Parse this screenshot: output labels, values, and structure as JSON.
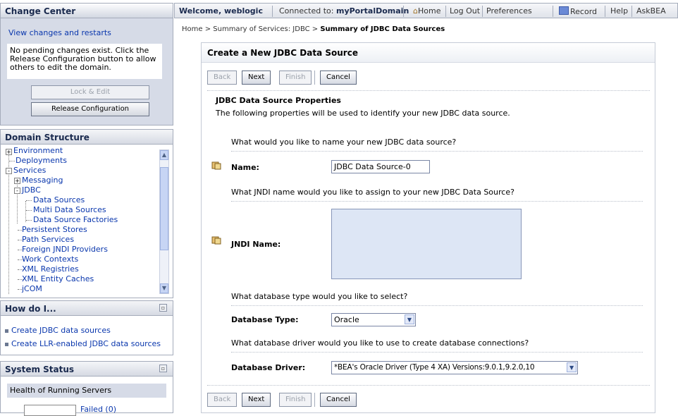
{
  "change_center": {
    "title": "Change Center",
    "link": "View changes and restarts",
    "message": "No pending changes exist. Click the Release Configuration button to allow others to edit the domain.",
    "lock_label": "Lock & Edit",
    "release_label": "Release Configuration"
  },
  "domain_structure": {
    "title": "Domain Structure",
    "items": [
      {
        "label": "Environment",
        "expander": "+"
      },
      {
        "label": "Deployments"
      },
      {
        "label": "Services",
        "expander": "-"
      },
      {
        "label": "Messaging",
        "expander": "+"
      },
      {
        "label": "JDBC",
        "expander": "-"
      },
      {
        "label": "Data Sources"
      },
      {
        "label": "Multi Data Sources"
      },
      {
        "label": "Data Source Factories"
      },
      {
        "label": "Persistent Stores"
      },
      {
        "label": "Path Services"
      },
      {
        "label": "Foreign JNDI Providers"
      },
      {
        "label": "Work Contexts"
      },
      {
        "label": "XML Registries"
      },
      {
        "label": "XML Entity Caches"
      },
      {
        "label": "jCOM"
      }
    ]
  },
  "how_do_i": {
    "title": "How do I...",
    "items": [
      "Create JDBC data sources",
      "Create LLR-enabled JDBC data sources"
    ]
  },
  "system_status": {
    "title": "System Status",
    "health_label": "Health of Running Servers",
    "failed_label": "Failed (0)"
  },
  "topbar": {
    "welcome": "Welcome, weblogic",
    "connected_prefix": "Connected to: ",
    "domain": "myPortalDomain",
    "home": "Home",
    "logout": "Log Out",
    "preferences": "Preferences",
    "record": "Record",
    "help": "Help",
    "askbea": "AskBEA"
  },
  "breadcrumb": {
    "path": "Home > Summary of Services: JDBC > ",
    "current": "Summary of JDBC Data Sources"
  },
  "form": {
    "title": "Create a New JDBC Data Source",
    "buttons": {
      "back": "Back",
      "next": "Next",
      "finish": "Finish",
      "cancel": "Cancel"
    },
    "section_title": "JDBC Data Source Properties",
    "section_desc": "The following properties will be used to identify your new JDBC data source.",
    "q_name": "What would you like to name your new JDBC data source?",
    "name_label": "Name:",
    "name_value": "JDBC Data Source-0",
    "q_jndi": "What JNDI name would you like to assign to your new JDBC Data Source?",
    "jndi_label": "JNDI Name:",
    "jndi_value": "",
    "q_dbtype": "What database type would you like to select?",
    "dbtype_label": "Database Type:",
    "dbtype_value": "Oracle",
    "q_driver": "What database driver would you like to use to create database connections?",
    "driver_label": "Database Driver:",
    "driver_value": "*BEA's Oracle Driver (Type 4 XA) Versions:9.0.1,9.2.0,10"
  }
}
